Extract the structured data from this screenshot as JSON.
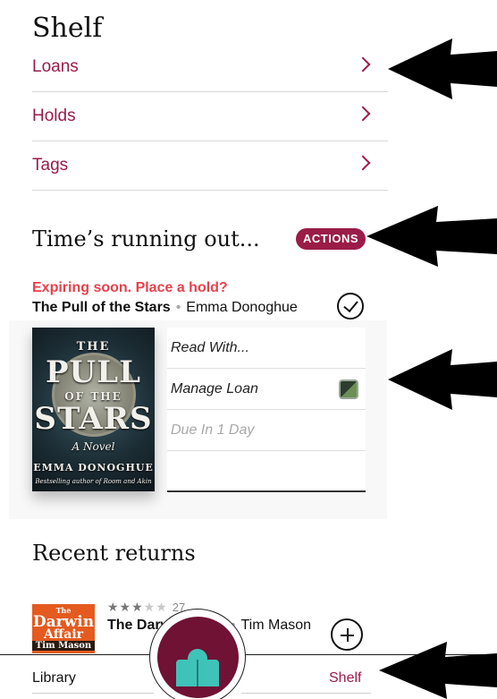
{
  "shelf": {
    "title": "Shelf",
    "menu": [
      {
        "label": "Loans"
      },
      {
        "label": "Holds"
      },
      {
        "label": "Tags"
      }
    ]
  },
  "expiring": {
    "title": "Time’s running out...",
    "actions_label": "ACTIONS",
    "notice": "Expiring soon. Place a hold?",
    "book_title": "The Pull of the Stars",
    "book_author": "Emma Donoghue",
    "cover": {
      "l1": "THE",
      "l2": "PULL",
      "l3": "OF THE",
      "l4": "STARS",
      "l5": "A Novel",
      "l6": "EMMA DONOGHUE",
      "l7": "Bestselling author of Room and Akin"
    },
    "options": [
      {
        "label": "Read With..."
      },
      {
        "label": "Manage Loan",
        "icon": "loan-status-icon"
      },
      {
        "label": "Due In 1 Day"
      }
    ]
  },
  "recent": {
    "title": "Recent returns",
    "rating_stars": 3,
    "rating_count": "27",
    "book_title": "The Darwin Affair",
    "book_author": "Tim Mason",
    "cover": {
      "l1": "The",
      "l2": "Darwin",
      "l3": "Affair",
      "l4": "Tim Mason"
    }
  },
  "tabbar": {
    "library_label": "Library",
    "shelf_label": "Shelf"
  },
  "colors": {
    "accent": "#9a1c47",
    "warning": "#e8414b",
    "fab": "#6f1234",
    "fab_icon": "#3fc3b8"
  }
}
